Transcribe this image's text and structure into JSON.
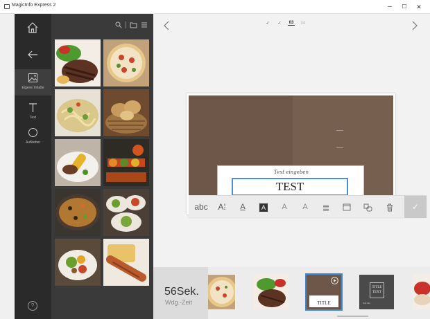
{
  "window": {
    "title": "MagicInfo Express 2",
    "controls": {
      "minimize": "–",
      "maximize": "☐",
      "close": "✕"
    }
  },
  "navrail": {
    "home_icon": "home-icon",
    "back_icon": "back-arrow-icon",
    "items": [
      {
        "label": "Eigene Inhalte",
        "icon": "image-icon",
        "active": true
      },
      {
        "label": "Text",
        "icon": "text-icon",
        "active": false
      },
      {
        "label": "Aufkleber",
        "icon": "sticker-icon",
        "active": false
      }
    ],
    "help_label": "?"
  },
  "gallery": {
    "tool_icons": [
      "search-icon",
      "folder-icon",
      "list-view-icon"
    ],
    "thumbnails": [
      "steak with salad",
      "pizza",
      "pasta with vegetables",
      "bread basket",
      "grilled corn plate",
      "vegetable skewers",
      "paella pan",
      "salad bowls",
      "salad plate",
      "sausage with fries"
    ]
  },
  "steps": {
    "items": [
      "✓",
      "✓",
      "03",
      "04"
    ],
    "current_index": 2
  },
  "slide": {
    "script_text": "Text eingeben",
    "main_text": "TEST"
  },
  "text_toolbar": {
    "buttons": [
      {
        "label": "abc",
        "icon": "text-style-icon"
      },
      {
        "label": "A⁞",
        "icon": "font-size-icon"
      },
      {
        "label": "A",
        "icon": "text-color-icon"
      },
      {
        "label": "A",
        "icon": "text-background-icon"
      },
      {
        "label": "A",
        "icon": "text-outline-icon"
      },
      {
        "label": "A",
        "icon": "text-shadow-icon"
      },
      {
        "label": "",
        "icon": "align-icon"
      },
      {
        "label": "",
        "icon": "frame-icon"
      },
      {
        "label": "",
        "icon": "arrange-icon"
      },
      {
        "label": "",
        "icon": "delete-icon"
      },
      {
        "label": "✓",
        "icon": "confirm-icon"
      }
    ]
  },
  "filmstrip": {
    "duration_value": "56Sek.",
    "duration_label": "Wdg.-Zeit",
    "frames": [
      {
        "content": "pizza",
        "selected": false
      },
      {
        "content": "steak with salad",
        "selected": false
      },
      {
        "content": "brown template",
        "selected": true,
        "text": "TITLE",
        "has_play": true
      },
      {
        "content": "dark template",
        "selected": false,
        "text": "TITLE\nTEXT",
        "subtext": "Sub title"
      },
      {
        "content": "food",
        "selected": false
      }
    ]
  },
  "colors": {
    "accent": "#3d86d4",
    "navrail_bg": "#2a2a2a",
    "gallery_bg": "#3a3a3a",
    "slide_brown": "#6e5648"
  }
}
